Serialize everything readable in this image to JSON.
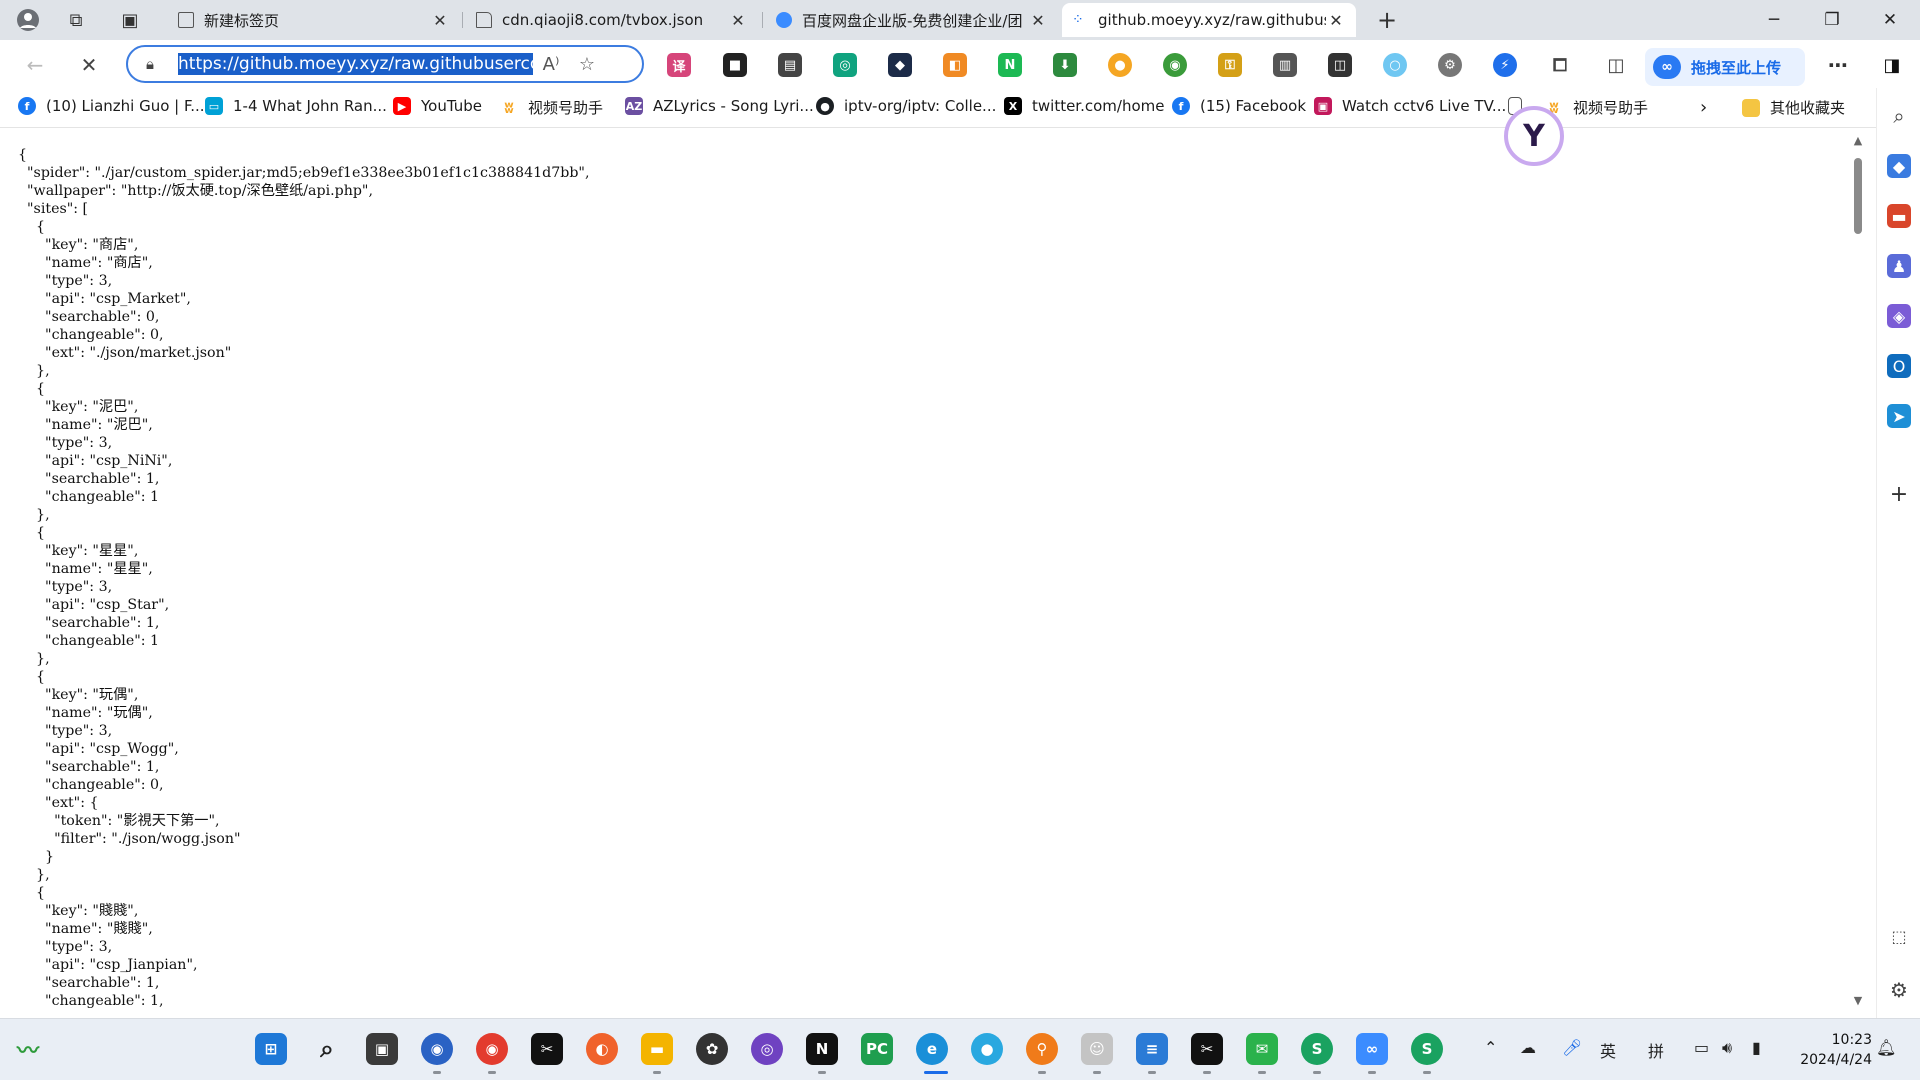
{
  "tabs": [
    {
      "title": "新建标签页",
      "icon": "new-tab-page-icon",
      "active": false
    },
    {
      "title": "cdn.qiaoji8.com/tvbox.json",
      "icon": "document-icon",
      "active": false
    },
    {
      "title": "百度网盘企业版-免费创建企业/团",
      "icon": "baidu-netdisk-icon",
      "active": false
    },
    {
      "title": "github.moeyy.xyz/raw.githubuse",
      "icon": "loading-icon",
      "active": true
    }
  ],
  "address_bar": {
    "url": "https://github.moeyy.xyz/raw.githubuserconte"
  },
  "upload_widget": {
    "label": "拖拽至此上传"
  },
  "bookmarks": [
    {
      "label": "(10) Lianzhi Guo | F...",
      "icon": "facebook-icon",
      "color": "#1877f2"
    },
    {
      "label": "1-4 What John Ran...",
      "icon": "bilibili-icon",
      "color": "#00a1d6"
    },
    {
      "label": "YouTube",
      "icon": "youtube-icon",
      "color": "#ff0000"
    },
    {
      "label": "视频号助手",
      "icon": "wechat-channels-icon",
      "color": "#f6a623"
    },
    {
      "label": "AZLyrics - Song Lyri...",
      "icon": "azlyrics-icon",
      "color": "#6b4fa1"
    },
    {
      "label": "iptv-org/iptv: Colle...",
      "icon": "github-icon",
      "color": "#1b1f23"
    },
    {
      "label": "twitter.com/home",
      "icon": "x-icon",
      "color": "#000000"
    },
    {
      "label": "(15) Facebook",
      "icon": "facebook-icon",
      "color": "#1877f2"
    },
    {
      "label": "Watch cctv6 Live TV...",
      "icon": "cctv-icon",
      "color": "#c2185b"
    },
    {
      "label": "视频号助手",
      "icon": "wechat-channels-icon",
      "color": "#f6a623"
    }
  ],
  "bookmarks_overflow": {
    "label": "其他收藏夹"
  },
  "json_text": "{\n  \"spider\": \"./jar/custom_spider.jar;md5;eb9ef1e338ee3b01ef1c1c388841d7bb\",\n  \"wallpaper\": \"http://饭太硬.top/深色壁纸/api.php\",\n  \"sites\": [\n    {\n      \"key\": \"商店\",\n      \"name\": \"商店\",\n      \"type\": 3,\n      \"api\": \"csp_Market\",\n      \"searchable\": 0,\n      \"changeable\": 0,\n      \"ext\": \"./json/market.json\"\n    },\n    {\n      \"key\": \"泥巴\",\n      \"name\": \"泥巴\",\n      \"type\": 3,\n      \"api\": \"csp_NiNi\",\n      \"searchable\": 1,\n      \"changeable\": 1\n    },\n    {\n      \"key\": \"星星\",\n      \"name\": \"星星\",\n      \"type\": 3,\n      \"api\": \"csp_Star\",\n      \"searchable\": 1,\n      \"changeable\": 1\n    },\n    {\n      \"key\": \"玩偶\",\n      \"name\": \"玩偶\",\n      \"type\": 3,\n      \"api\": \"csp_Wogg\",\n      \"searchable\": 1,\n      \"changeable\": 0,\n      \"ext\": {\n        \"token\": \"影視天下第一\",\n        \"filter\": \"./json/wogg.json\"\n      }\n    },\n    {\n      \"key\": \"賤賤\",\n      \"name\": \"賤賤\",\n      \"type\": 3,\n      \"api\": \"csp_Jianpian\",\n      \"searchable\": 1,\n      \"changeable\": 1,",
  "taskbar": {
    "apps": [
      {
        "icon": "start-icon",
        "color": "#1e78d7"
      },
      {
        "icon": "search-icon",
        "color": "#3a3a3a"
      },
      {
        "icon": "task-view-icon",
        "color": "#3a3a3a"
      },
      {
        "icon": "chrome-canary-icon",
        "color": "#2a62c4"
      },
      {
        "icon": "chrome-icon",
        "color": "#e33b2e"
      },
      {
        "icon": "capcut-icon",
        "color": "#111111"
      },
      {
        "icon": "firefox-icon",
        "color": "#f0622b"
      },
      {
        "icon": "file-explorer-icon",
        "color": "#f4b400"
      },
      {
        "icon": "davinci-resolve-icon",
        "color": "#333333"
      },
      {
        "icon": "github-desktop-icon",
        "color": "#6f42c1"
      },
      {
        "icon": "notion-icon",
        "color": "#111111"
      },
      {
        "icon": "pycharm-icon",
        "color": "#1f9e4f"
      },
      {
        "icon": "edge-icon",
        "color": "#1a8fd8"
      },
      {
        "icon": "app-circle-icon",
        "color": "#29a8e0"
      },
      {
        "icon": "magnifier-app-icon",
        "color": "#f07b1a"
      },
      {
        "icon": "pdf24-icon",
        "color": "#c4c4c4"
      },
      {
        "icon": "notepad-icon",
        "color": "#2b7bd6"
      },
      {
        "icon": "capcut-icon",
        "color": "#111111"
      },
      {
        "icon": "wechat-icon",
        "color": "#2bb24c"
      },
      {
        "icon": "screenshot-app-icon",
        "color": "#1aa260"
      },
      {
        "icon": "baidu-netdisk-icon",
        "color": "#3b8cff"
      },
      {
        "icon": "screenshot-app-icon",
        "color": "#1aa260"
      }
    ],
    "tray": {
      "ime_lang": "英",
      "ime_mode": "拼"
    },
    "time": "10:23",
    "date": "2024/4/24"
  }
}
